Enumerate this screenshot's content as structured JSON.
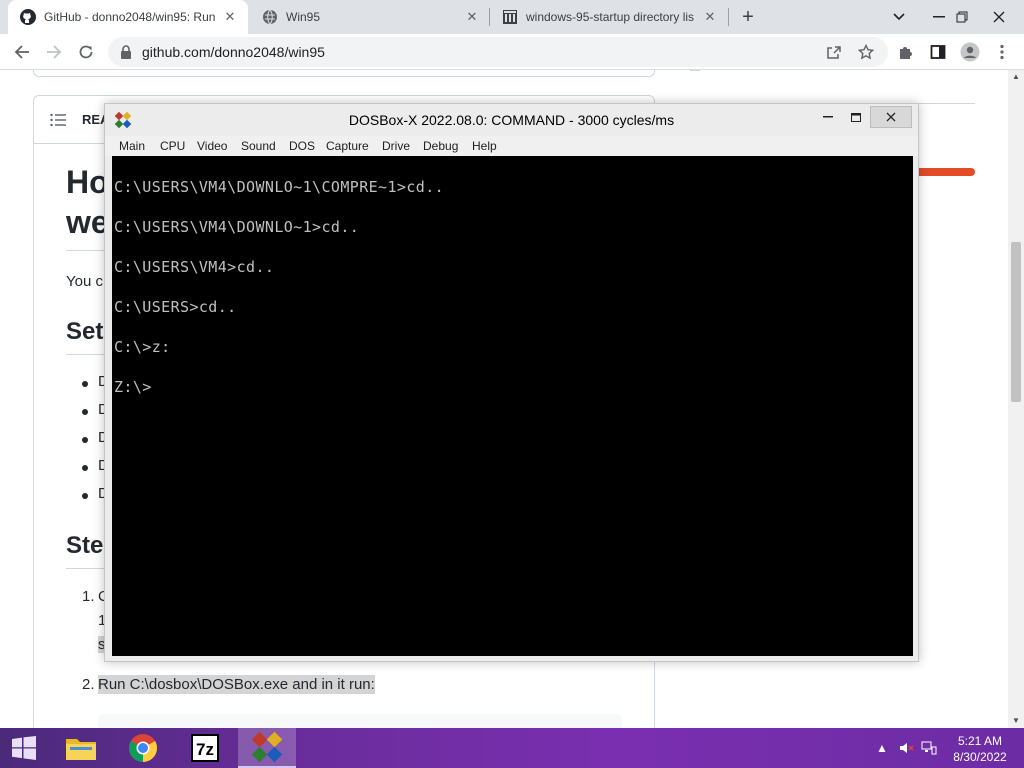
{
  "browser": {
    "tabs": [
      {
        "title": "GitHub - donno2048/win95: Run",
        "icon": "github-icon",
        "active": true
      },
      {
        "title": "Win95",
        "icon": "globe-icon",
        "active": false
      },
      {
        "title": "windows-95-startup directory lis",
        "icon": "archive-icon",
        "active": false
      }
    ],
    "new_tab_label": "+",
    "url": "github.com/donno2048/win95"
  },
  "readme": {
    "header_label": "REA",
    "h1_line1": "Ho",
    "h1_line2": "we",
    "intro_text": "You c",
    "setup_heading": "Setu",
    "setup_items": [
      "D",
      "D",
      "D",
      "D",
      "D"
    ],
    "steps_heading": "Step",
    "step1_num": "1.",
    "step1_line1": "C",
    "step1_line2": "1",
    "step1_line3": "s",
    "step2_num": "2.",
    "step2_text": "Run C:\\dosbox\\DOSBox.exe and in it run:"
  },
  "dosbox": {
    "title": "DOSBox-X 2022.08.0: COMMAND - 3000 cycles/ms",
    "menu": [
      "Main",
      "CPU",
      "Video",
      "Sound",
      "DOS",
      "Capture",
      "Drive",
      "Debug",
      "Help"
    ],
    "console_lines": [
      "C:\\USERS\\VM4\\DOWNLO~1\\COMPRE~1>cd..",
      "C:\\USERS\\VM4\\DOWNLO~1>cd..",
      "C:\\USERS\\VM4>cd..",
      "C:\\USERS>cd..",
      "C:\\>z:",
      "Z:\\>"
    ],
    "text_color": "#c0c0c0",
    "background_color": "#000000"
  },
  "taskbar": {
    "apps": [
      "file-explorer-icon",
      "chrome-icon",
      "7zip-icon",
      "dosbox-icon"
    ],
    "app_7z_label": "7z",
    "time": "5:21 AM",
    "date": "8/30/2022"
  },
  "colors": {
    "accent_orange": "#e34c26",
    "taskbar_purple": "#6a2d9c"
  }
}
